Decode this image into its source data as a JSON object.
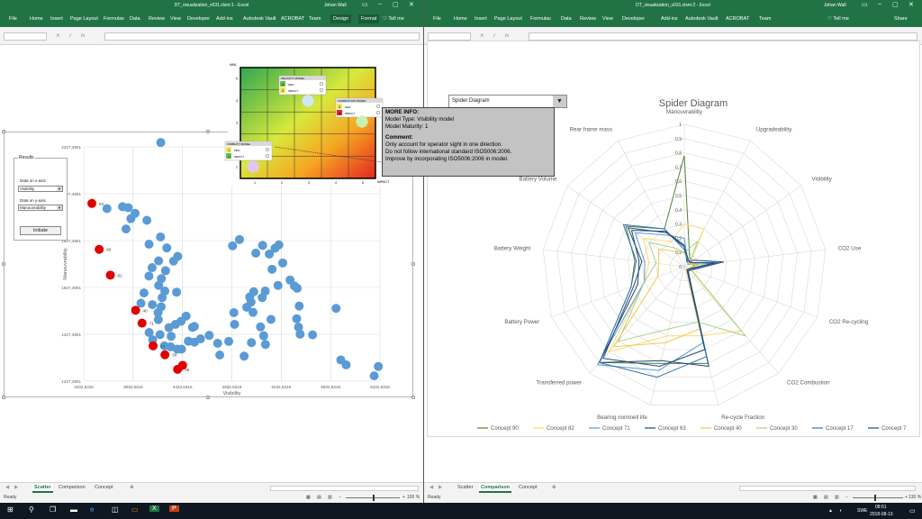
{
  "left_window": {
    "title": "DT_visualization_v031.xlsm:1  -  Excel",
    "user": "Johan Wall",
    "menu": [
      "File",
      "Home",
      "Insert",
      "Page Layout",
      "Formulas",
      "Data",
      "Review",
      "View",
      "Developer",
      "Add-ins",
      "Autodesk Vault",
      "ACROBAT",
      "Team",
      "Design",
      "Format"
    ],
    "tell_me": "Tell me",
    "fx": "fx",
    "sheet_tabs": [
      "Scatter",
      "Comparison",
      "Concept"
    ],
    "active_tab": "Scatter",
    "status": "Ready",
    "zoom": "100 %",
    "results": {
      "legend": "Results",
      "x_label": "Data on x-axis",
      "x_value": "Visibility",
      "y_label": "Data on y-axis",
      "y_value": "Manouvrability",
      "button": "Initiate"
    },
    "tooltip": {
      "heading": "MORE INFO:",
      "lines": [
        "Model Type: Visibility model",
        "Model Maturity: 1"
      ],
      "comment_heading": "Comment:",
      "comment_lines": [
        "Only account for operator sight in one direction.",
        "Do not follow international standard ISO5006:2006.",
        "Improve by incorporating ISO5006:2006 in model."
      ]
    }
  },
  "right_window": {
    "title": "DT_visualization_v031.xlsm:2  -  Excel",
    "user": "Johan Wall",
    "menu": [
      "File",
      "Home",
      "Insert",
      "Page Layout",
      "Formulas",
      "Data",
      "Review",
      "View",
      "Developer",
      "Add-ins",
      "Autodesk Vault",
      "ACROBAT",
      "Team"
    ],
    "tell_me": "Tell me",
    "share": "Share",
    "fx": "fx",
    "sheet_tabs": [
      "Scatter",
      "Comparison",
      "Concept"
    ],
    "active_tab": "Comparison",
    "status": "Ready",
    "zoom": "130 %",
    "dropdown_value": "Spider Diagram"
  },
  "taskbar": {
    "lang": "SWE",
    "time": "08:51",
    "date": "2018-08-13"
  },
  "maturity_matrix": {
    "y_axis_title": "MML",
    "x_axis_title": "IMPACT",
    "y_ticks": [
      "5",
      "4",
      "3",
      "2",
      "1"
    ],
    "x_ticks": [
      "1",
      "2",
      "3",
      "4",
      "5"
    ],
    "cards": [
      {
        "title": "VELOCITY MODEL",
        "r1": "4",
        "l1": "MML",
        "r2": "3",
        "l2": "IMPACT",
        "c1": "#6abf4b",
        "c2": "#f6e64b"
      },
      {
        "title": "COMPACTION MODEL",
        "r1": "2",
        "l1": "MML",
        "r2": "5",
        "l2": "IMPACT",
        "c1": "#f6e64b",
        "c2": "#e3262b"
      },
      {
        "title": "VISIBILITY MODEL",
        "r1": "1",
        "l1": "MML",
        "r2": "1",
        "l2": "IMPACT",
        "c1": "#f6e64b",
        "c2": "#6abf4b"
      }
    ]
  },
  "chart_data": [
    {
      "type": "scatter",
      "title": "",
      "xlabel": "Visibility",
      "ylabel": "Manouvrability",
      "x_ticks": [
        "3432,6316",
        "3932,6316",
        "4432,6316",
        "4932,6316",
        "5432,6316",
        "5932,6316",
        "6432,6316"
      ],
      "y_ticks": [
        "2227,4901",
        "2027,4901",
        "1827,4901",
        "1627,4901",
        "1427,4901",
        "1227,4901"
      ],
      "xlim": [
        3432.6316,
        6432.6316
      ],
      "ylim": [
        1227.4901,
        2227.4901
      ],
      "series": [
        {
          "name": "Concepts",
          "color": "#5b9bd5",
          "points": [
            [
              4213,
              2246
            ],
            [
              3668,
              1964
            ],
            [
              3826,
              1972
            ],
            [
              3883,
              1968
            ],
            [
              3953,
              1944
            ],
            [
              3910,
              1921
            ],
            [
              4072,
              1914
            ],
            [
              3861,
              1877
            ],
            [
              4210,
              1843
            ],
            [
              4094,
              1812
            ],
            [
              4274,
              1796
            ],
            [
              4384,
              1760
            ],
            [
              4342,
              1740
            ],
            [
              4191,
              1741
            ],
            [
              4125,
              1712
            ],
            [
              4261,
              1699
            ],
            [
              4093,
              1676
            ],
            [
              4219,
              1665
            ],
            [
              4192,
              1636
            ],
            [
              4254,
              1612
            ],
            [
              4043,
              1604
            ],
            [
              4227,
              1584
            ],
            [
              4373,
              1607
            ],
            [
              4012,
              1560
            ],
            [
              4128,
              1554
            ],
            [
              4217,
              1545
            ],
            [
              4185,
              1520
            ],
            [
              4188,
              1490
            ],
            [
              4418,
              1483
            ],
            [
              4469,
              1505
            ],
            [
              4362,
              1470
            ],
            [
              4534,
              1457
            ],
            [
              4553,
              1461
            ],
            [
              4095,
              1435
            ],
            [
              4296,
              1456
            ],
            [
              4205,
              1426
            ],
            [
              4131,
              1404
            ],
            [
              4318,
              1419
            ],
            [
              4250,
              1378
            ],
            [
              4312,
              1374
            ],
            [
              4380,
              1364
            ],
            [
              4423,
              1364
            ],
            [
              4492,
              1398
            ],
            [
              4554,
              1394
            ],
            [
              4615,
              1408
            ],
            [
              4703,
              1423
            ],
            [
              4789,
              1389
            ],
            [
              4960,
              1470
            ],
            [
              4953,
              1520
            ],
            [
              5083,
              1543
            ],
            [
              5154,
              1609
            ],
            [
              5127,
              1565
            ],
            [
              5147,
              1521
            ],
            [
              5113,
              1587
            ],
            [
              5240,
              1584
            ],
            [
              5271,
              1612
            ],
            [
              5400,
              1636
            ],
            [
              5340,
              1705
            ],
            [
              5448,
              1732
            ],
            [
              5312,
              1770
            ],
            [
              5370,
              1795
            ],
            [
              5409,
              1809
            ],
            [
              5244,
              1807
            ],
            [
              5175,
              1774
            ],
            [
              5010,
              1832
            ],
            [
              4940,
              1805
            ],
            [
              5522,
              1659
            ],
            [
              5566,
              1634
            ],
            [
              5594,
              1624
            ],
            [
              5615,
              1548
            ],
            [
              5589,
              1494
            ],
            [
              5608,
              1458
            ],
            [
              5624,
              1428
            ],
            [
              5750,
              1425
            ],
            [
              5988,
              1538
            ],
            [
              5223,
              1459
            ],
            [
              5255,
              1421
            ],
            [
              4901,
              1397
            ],
            [
              4810,
              1339
            ],
            [
              5057,
              1334
            ],
            [
              5131,
              1392
            ],
            [
              5273,
              1384
            ],
            [
              5329,
              1491
            ],
            [
              6036,
              1318
            ],
            [
              6090,
              1297
            ],
            [
              6416,
              1290
            ],
            [
              6374,
              1250
            ]
          ]
        },
        {
          "name": "Selected",
          "color": "#e00000",
          "points": [
            [
              3515,
              1986
            ],
            [
              3589,
              1790
            ],
            [
              3702,
              1680
            ],
            [
              3958,
              1530
            ],
            [
              4023,
              1475
            ],
            [
              4135,
              1378
            ],
            [
              4255,
              1340
            ],
            [
              4434,
              1295
            ],
            [
              4383,
              1278
            ]
          ],
          "labels": [
            "63",
            "90",
            "82",
            "40",
            "71",
            "17",
            "30",
            "",
            "36"
          ]
        }
      ]
    },
    {
      "type": "radar",
      "title": "Spider Diagram",
      "axes": [
        "Manouvrability",
        "Upgradeability",
        "Visibility",
        "CO2 Use",
        "CO2 Re-cycling",
        "CO2 Combustion",
        "Re-cycle Fraction",
        "Bearing nominell life",
        "Transferred power",
        "Battery Power",
        "Battery Weight",
        "Battery Volume",
        "Rear frame mass"
      ],
      "r_ticks": [
        "0",
        "0,1",
        "0,2",
        "0,3",
        "0,4",
        "0,5",
        "0,6",
        "0,7",
        "0,8",
        "0,9",
        "1"
      ],
      "rlim": [
        0,
        1
      ],
      "series": [
        {
          "name": "Concept 90",
          "color": "#548235",
          "values": [
            0.78,
            0.08,
            0.06,
            0.07,
            0.05,
            0.04,
            0.7,
            0.7,
            0.9,
            0.4,
            0.35,
            0.5,
            0.3
          ]
        },
        {
          "name": "Concept 82",
          "color": "#ffd966",
          "values": [
            0.3,
            0.3,
            0.05,
            0.06,
            0.04,
            0.6,
            0.5,
            0.5,
            0.8,
            0.3,
            0.25,
            0.35,
            0.2
          ]
        },
        {
          "name": "Concept 71",
          "color": "#5b9bd5",
          "values": [
            0.2,
            0.05,
            0.03,
            0.2,
            0.04,
            0.04,
            0.55,
            0.75,
            0.92,
            0.3,
            0.28,
            0.42,
            0.25
          ]
        },
        {
          "name": "Concept 63",
          "color": "#264478",
          "values": [
            0.15,
            0.04,
            0.08,
            0.28,
            0.06,
            0.04,
            0.72,
            0.68,
            0.9,
            0.35,
            0.32,
            0.45,
            0.28
          ]
        },
        {
          "name": "Concept 40",
          "color": "#f2c94c",
          "values": [
            0.1,
            0.05,
            0.04,
            0.1,
            0.03,
            0.02,
            0.45,
            0.55,
            0.75,
            0.2,
            0.18,
            0.22,
            0.12
          ]
        },
        {
          "name": "Concept 30",
          "color": "#a9d18e",
          "values": [
            0.1,
            0.2,
            0.05,
            0.15,
            0.05,
            0.65,
            0.4,
            0.45,
            0.7,
            0.3,
            0.2,
            0.3,
            0.15
          ]
        },
        {
          "name": "Concept 17",
          "color": "#2e75b6",
          "values": [
            0.12,
            0.05,
            0.05,
            0.25,
            0.05,
            0.03,
            0.65,
            0.8,
            0.9,
            0.4,
            0.34,
            0.52,
            0.3
          ]
        },
        {
          "name": "Concept 7",
          "color": "#1f4e79",
          "values": [
            0.14,
            0.06,
            0.05,
            0.22,
            0.04,
            0.03,
            0.6,
            0.72,
            0.86,
            0.38,
            0.3,
            0.48,
            0.27
          ]
        }
      ]
    }
  ]
}
